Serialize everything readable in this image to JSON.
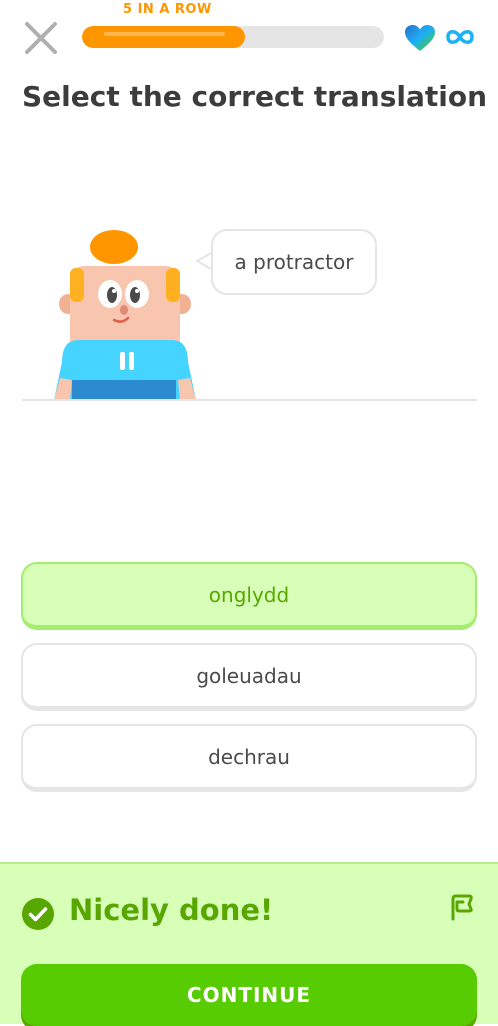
{
  "header": {
    "streak_label": "5 IN A ROW",
    "progress": 0.54,
    "hearts_icon": "heart-icon",
    "hearts_value_icon": "infinity-icon"
  },
  "challenge": {
    "title": "Select the correct translation",
    "prompt": "a protractor"
  },
  "options": [
    {
      "label": "onglydd",
      "selected": true
    },
    {
      "label": "goleuadau",
      "selected": false
    },
    {
      "label": "dechrau",
      "selected": false
    }
  ],
  "feedback": {
    "message": "Nicely done!",
    "continue_label": "CONTINUE"
  },
  "colors": {
    "accent_green": "#58cc02",
    "success_text": "#58a700",
    "streak_orange": "#ff9600",
    "success_bg": "#d7ffb8"
  }
}
